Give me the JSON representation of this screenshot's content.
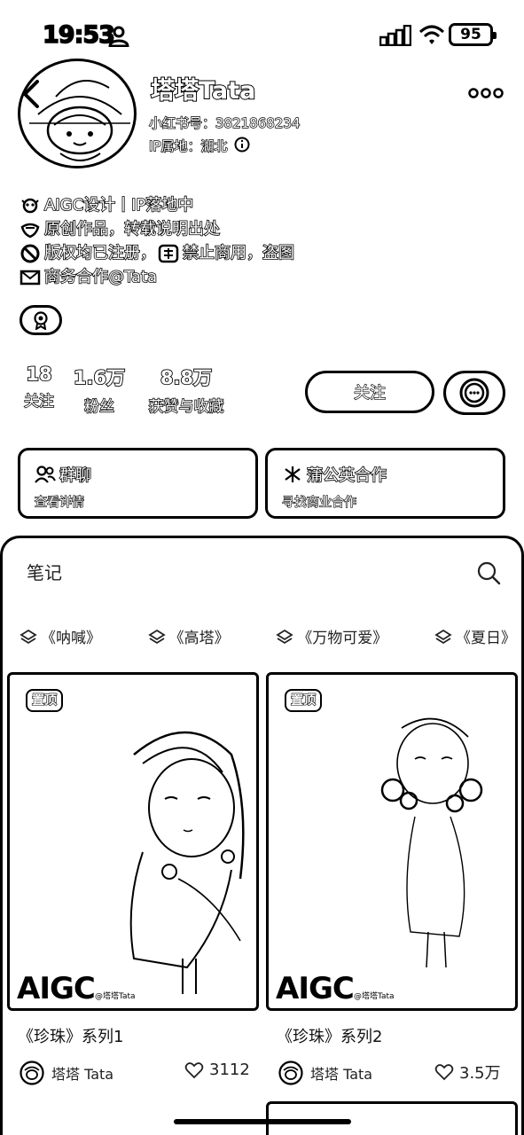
{
  "status_bar": {
    "time": "19:53",
    "battery": "95"
  },
  "profile": {
    "name": "塔塔Tata",
    "red_id": "小红书号：3821868234",
    "ip_location": "IP属地：湖北",
    "bio": [
      {
        "icon": "ai-icon",
        "text": "AIGC设计丨IP落地中"
      },
      {
        "icon": "heart-hand-icon",
        "text": "原创作品，转载说明出处"
      },
      {
        "icon": "forbidden-icon",
        "text": "版权均已注册，"
      },
      {
        "icon": "mail-icon",
        "text": "商务合作@Tata"
      }
    ],
    "bio_line3_extra": "禁止商用，盗图",
    "stats": [
      {
        "num": "18",
        "label": "关注"
      },
      {
        "num": "1.6万",
        "label": "粉丝"
      },
      {
        "num": "8.8万",
        "label": "获赞与收藏"
      }
    ],
    "follow_label": "关注"
  },
  "cards": [
    {
      "title": "群聊",
      "subtitle": "查看详情",
      "icon": "group-icon"
    },
    {
      "title": "蒲公英合作",
      "subtitle": "寻找商业合作",
      "icon": "dandelion-icon"
    }
  ],
  "notes": {
    "title": "笔记",
    "albums": [
      "《呐喊》",
      "《高塔》",
      "《万物可爱》",
      "《夏日》"
    ]
  },
  "posts": [
    {
      "pin": "置顶",
      "aigc": "AIGC",
      "handle": "@塔塔Tata",
      "title": "《珍珠》系列1",
      "author": "塔塔 Tata",
      "likes": "3112"
    },
    {
      "pin": "置顶",
      "aigc": "AIGC",
      "handle": "@塔塔Tata",
      "title": "《珍珠》系列2",
      "author": "塔塔 Tata",
      "likes": "3.5万"
    }
  ]
}
